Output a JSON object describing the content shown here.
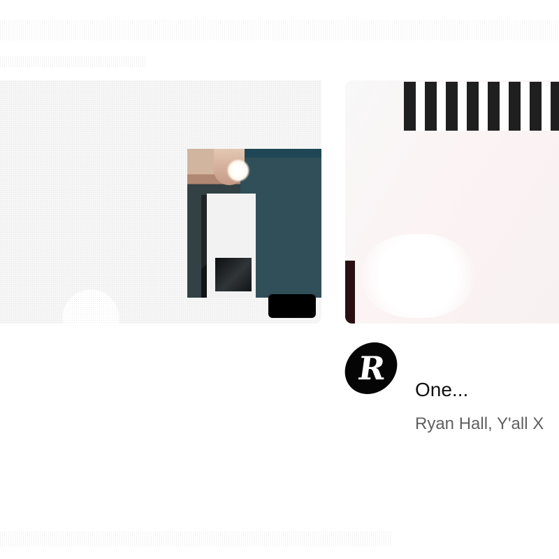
{
  "cards": [
    {
      "title": "",
      "channel": "",
      "views": "",
      "meta": "",
      "thumbnail": "video-thumbnail"
    },
    {
      "title_line_2": "One...",
      "channel": "Ryan Hall, Y'all X",
      "avatar_text": "R",
      "thumbnail": "video-thumbnail"
    }
  ]
}
